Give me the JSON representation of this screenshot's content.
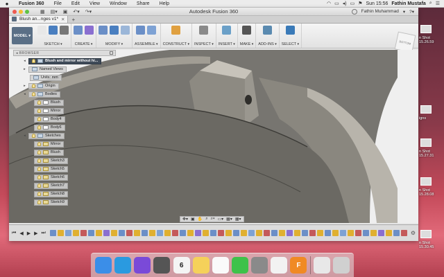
{
  "menubar": {
    "apple": "",
    "items": [
      "Fusion 360",
      "File",
      "Edit",
      "View",
      "Window",
      "Share",
      "Help"
    ],
    "clock": "Sun 15:56",
    "user": "Fathin Mustafa"
  },
  "window": {
    "title": "Autodesk Fusion 360",
    "account": "Fathin Muhammad",
    "tab_label": "Blush an...nges v1*",
    "mode": "MODEL"
  },
  "ribbon": {
    "groups": [
      {
        "label": "SKETCH",
        "colors": [
          "#e8e8e8",
          "#4a7fc0",
          "#777777"
        ]
      },
      {
        "label": "CREATE",
        "colors": [
          "#6b8fc7",
          "#8a6fd0"
        ]
      },
      {
        "label": "MODIFY",
        "colors": [
          "#6b8fc7",
          "#4a7fc0",
          "#9bb6d8"
        ]
      },
      {
        "label": "ASSEMBLE",
        "colors": [
          "#6b8fc7",
          "#7ea2d4"
        ]
      },
      {
        "label": "CONSTRUCT",
        "colors": [
          "#e0a040"
        ]
      },
      {
        "label": "INSPECT",
        "colors": [
          "#8a8a8a"
        ]
      },
      {
        "label": "INSERT",
        "colors": [
          "#6ba0c8"
        ]
      },
      {
        "label": "MAKE",
        "colors": [
          "#555555"
        ]
      },
      {
        "label": "ADD-INS",
        "colors": [
          "#5a8ab0"
        ]
      },
      {
        "label": "SELECT",
        "colors": [
          "#3a7ab8"
        ]
      }
    ],
    "viewcube": "BOTTOM"
  },
  "browser": {
    "header": "BROWSER",
    "root": "Blush and mirror without hi...",
    "named_views": "Named Views",
    "units": "Units: mm",
    "origin": "Origin",
    "bodies": "Bodies",
    "body_items": [
      "Blush",
      "Mirror",
      "Body4",
      "Body6"
    ],
    "sketches": "Sketches",
    "sketch_items": [
      "Mirror",
      "Blush",
      "Sketch3",
      "Sketch5",
      "Sketch6",
      "Sketch7",
      "Sketch8",
      "Sketch9"
    ]
  },
  "timeline": {
    "colors": [
      "#6b8fc7",
      "#e0b030",
      "#7ea2d4",
      "#e0b030",
      "#c45a5a",
      "#6b8fc7",
      "#e0b030",
      "#8a6fd0",
      "#e0b030",
      "#6b8fc7",
      "#c45a5a",
      "#e0b030"
    ]
  },
  "desktop": {
    "files": [
      {
        "name": "n Shot",
        "time": "15.26.59"
      },
      {
        "name": "igns",
        "time": ""
      },
      {
        "name": "n Shot",
        "time": "15.27.31"
      },
      {
        "name": "n Shot",
        "time": "15.28.08"
      },
      {
        "name": "n Shot",
        "time": "15.30.45"
      }
    ]
  },
  "dock": {
    "apps": [
      {
        "name": "finder-icon",
        "color": "#3b8ee8",
        "glyph": ""
      },
      {
        "name": "safari-icon",
        "color": "#2a9ae0",
        "glyph": ""
      },
      {
        "name": "siri-icon",
        "color": "#7a4ad8",
        "glyph": ""
      },
      {
        "name": "launchpad-icon",
        "color": "#555555",
        "glyph": ""
      },
      {
        "name": "calendar-icon",
        "color": "#f4f4f4",
        "glyph": "6"
      },
      {
        "name": "notes-icon",
        "color": "#f5d15a",
        "glyph": ""
      },
      {
        "name": "reminders-icon",
        "color": "#fafafa",
        "glyph": ""
      },
      {
        "name": "messages-icon",
        "color": "#3ec24a",
        "glyph": ""
      },
      {
        "name": "preferences-icon",
        "color": "#8a8a8a",
        "glyph": ""
      },
      {
        "name": "chrome-icon",
        "color": "#f2f2f2",
        "glyph": ""
      },
      {
        "name": "fusion-icon",
        "color": "#f08a24",
        "glyph": "F"
      },
      {
        "name": "photo-icon",
        "color": "#e8e8e8",
        "glyph": ""
      },
      {
        "name": "trash-icon",
        "color": "#d0d0d0",
        "glyph": ""
      }
    ]
  }
}
